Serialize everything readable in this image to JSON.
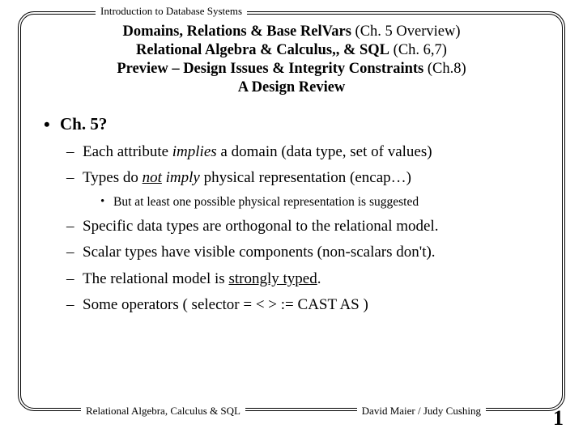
{
  "header": {
    "course": "Introduction to Database Systems"
  },
  "title": {
    "line1_bold": "Domains, Relations & Base RelVars",
    "line1_rest": " (Ch. 5 Overview)",
    "line2_bold": "Relational Algebra & Calculus,, & SQL",
    "line2_rest": " (Ch. 6,7)",
    "line3_bold": "Preview – Design Issues & Integrity Constraints",
    "line3_rest": " (Ch.8)",
    "line4_bold": "A Design Review"
  },
  "bullets": {
    "lvl1": "Ch. 5?",
    "b1_pre": "Each attribute ",
    "b1_it": "implies",
    "b1_post": " a domain (data type, set of values)",
    "b2_pre": "Types do ",
    "b2_not": "not",
    "b2_mid": " imply",
    "b2_post": " physical representation (encap…)",
    "b2_sub": "But at least one possible physical representation is suggested",
    "b3": "Specific data types are orthogonal to the relational model.",
    "b4": "Scalar types have visible components (non-scalars don't).",
    "b5_pre": "The relational model is ",
    "b5_ul": "strongly typed",
    "b5_post": ".",
    "b6": "Some operators  ( selector  =   <   >  :=   CAST AS )"
  },
  "footer": {
    "left": "Relational Algebra, Calculus & SQL",
    "right": "David Maier / Judy Cushing",
    "page": "1"
  }
}
